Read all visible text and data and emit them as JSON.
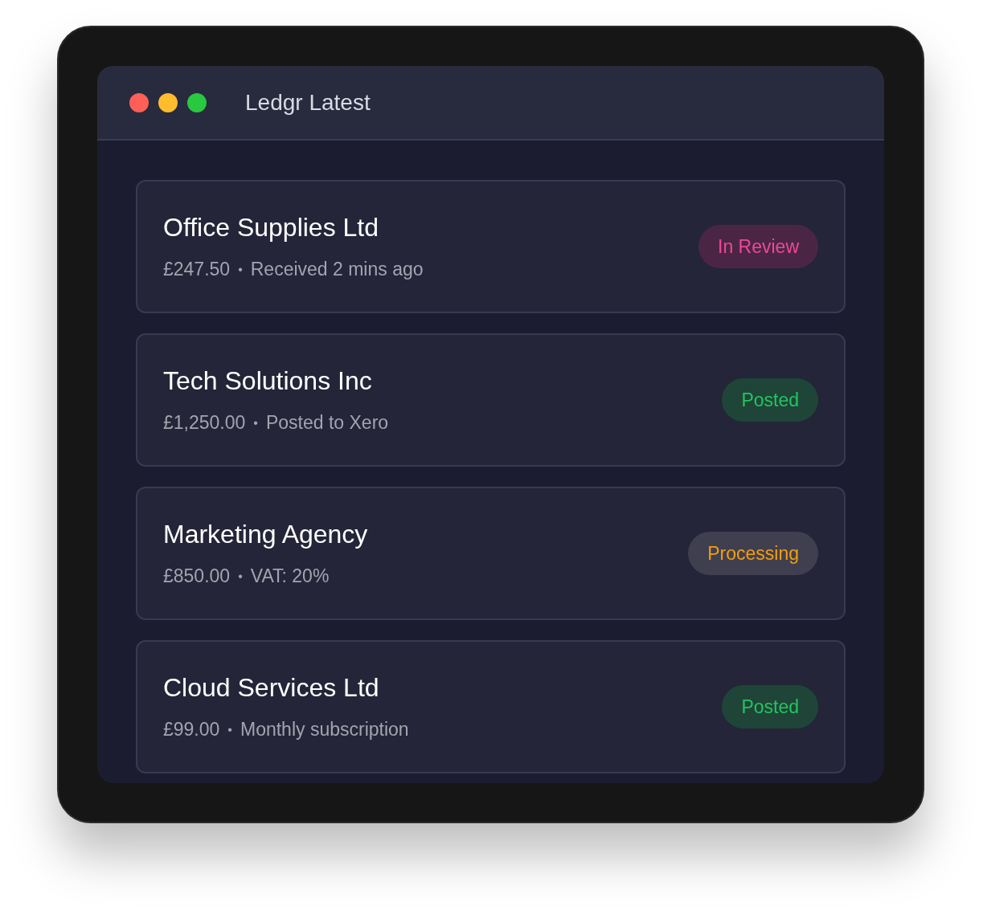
{
  "window": {
    "title": "Ledgr Latest"
  },
  "items": [
    {
      "name": "Office Supplies Ltd",
      "amount": "£247.50",
      "separator": "•",
      "detail": "Received 2 mins ago",
      "status": {
        "label": "In Review",
        "kind": "review"
      }
    },
    {
      "name": "Tech Solutions Inc",
      "amount": "£1,250.00",
      "separator": "•",
      "detail": "Posted to Xero",
      "status": {
        "label": "Posted",
        "kind": "posted"
      }
    },
    {
      "name": "Marketing Agency",
      "amount": "£850.00",
      "separator": "•",
      "detail": "VAT: 20%",
      "status": {
        "label": "Processing",
        "kind": "processing"
      }
    },
    {
      "name": "Cloud Services Ltd",
      "amount": "£99.00",
      "separator": "•",
      "detail": "Monthly subscription",
      "status": {
        "label": "Posted",
        "kind": "posted"
      }
    }
  ]
}
